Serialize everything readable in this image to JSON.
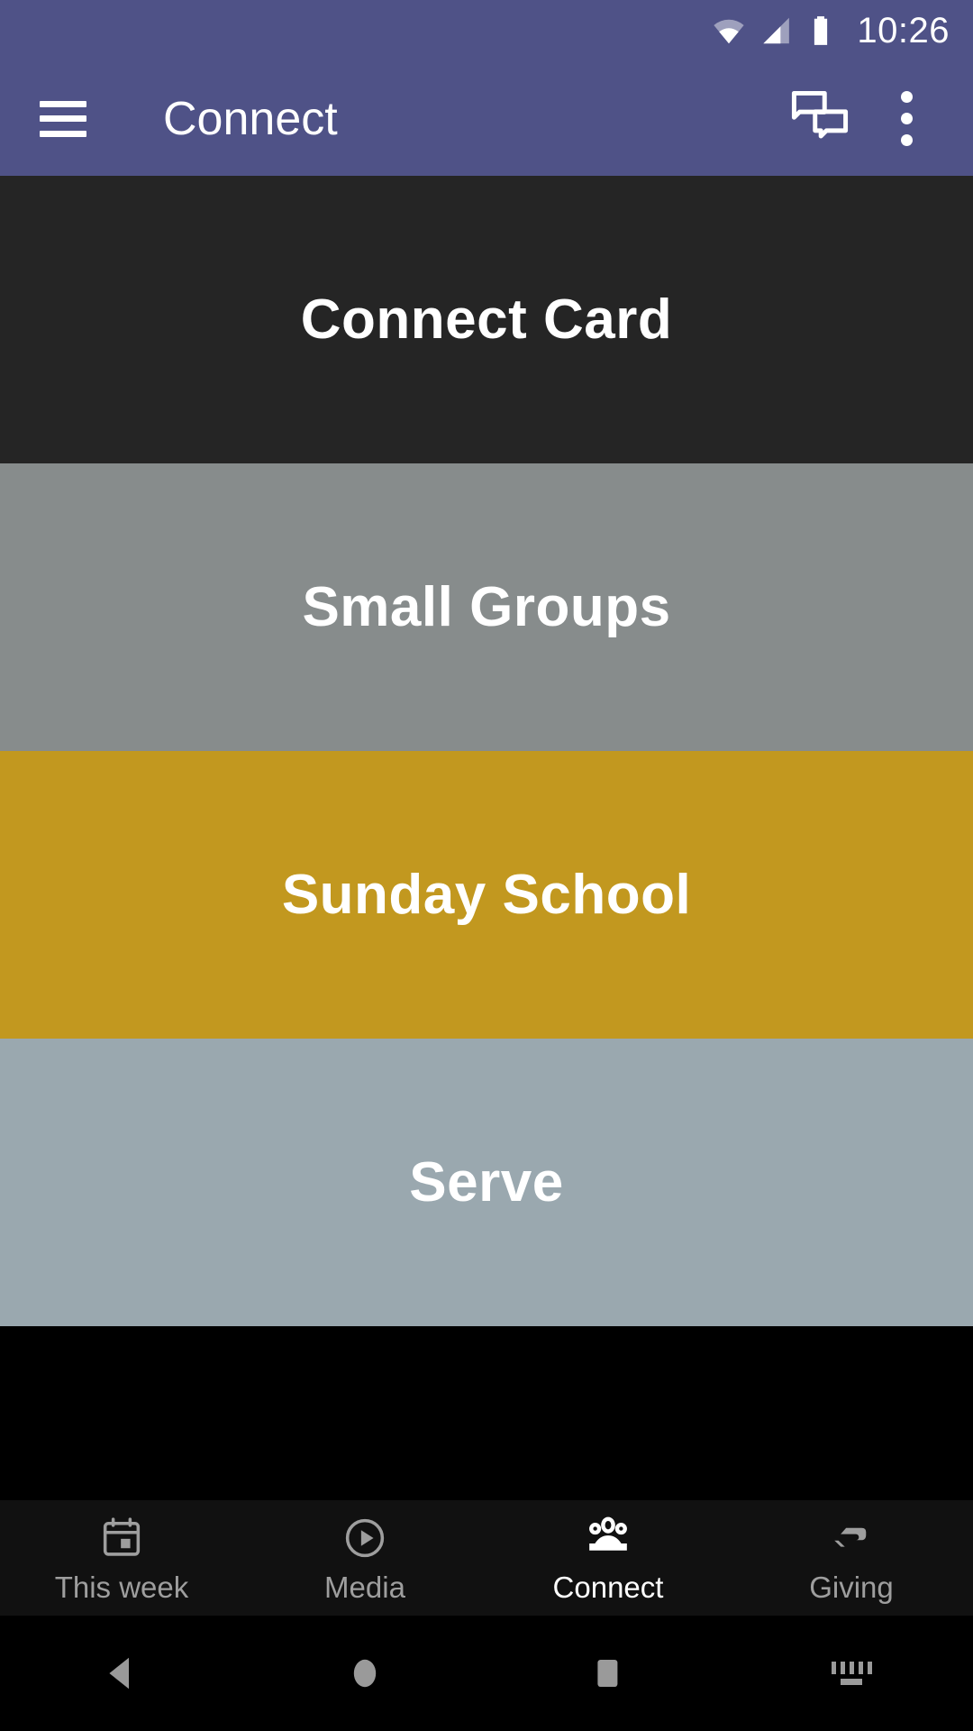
{
  "status_bar": {
    "time": "10:26",
    "icons": [
      "wifi-icon",
      "cellular-signal-icon",
      "battery-icon"
    ],
    "background_color": "#4f5287"
  },
  "app_bar": {
    "menu_icon": "hamburger-menu-icon",
    "title": "Connect",
    "chat_icon": "chat-bubbles-icon",
    "overflow_icon": "overflow-menu-icon",
    "background_color": "#4f5287",
    "text_color": "#ffffff"
  },
  "main": {
    "cards": [
      {
        "label": "Connect Card",
        "color": "#252525"
      },
      {
        "label": "Small Groups",
        "color": "#878c8c"
      },
      {
        "label": "Sunday School",
        "color": "#c2981f"
      },
      {
        "label": "Serve",
        "color": "#9aa8af"
      }
    ]
  },
  "bottom_nav": {
    "background_color": "#111111",
    "active_color": "#ffffff",
    "inactive_color": "#9e9e9e",
    "items": [
      {
        "label": "This week",
        "icon": "calendar-icon",
        "active": false
      },
      {
        "label": "Media",
        "icon": "play-circle-icon",
        "active": false
      },
      {
        "label": "Connect",
        "icon": "people-group-icon",
        "active": true
      },
      {
        "label": "Giving",
        "icon": "helping-hand-icon",
        "active": false
      }
    ]
  },
  "system_nav": {
    "background_color": "#000000",
    "buttons": [
      {
        "name": "back-button",
        "icon": "back-triangle-icon"
      },
      {
        "name": "home-button",
        "icon": "home-circle-icon"
      },
      {
        "name": "recents-button",
        "icon": "recents-square-icon"
      },
      {
        "name": "keyboard-button",
        "icon": "keyboard-icon"
      }
    ]
  }
}
